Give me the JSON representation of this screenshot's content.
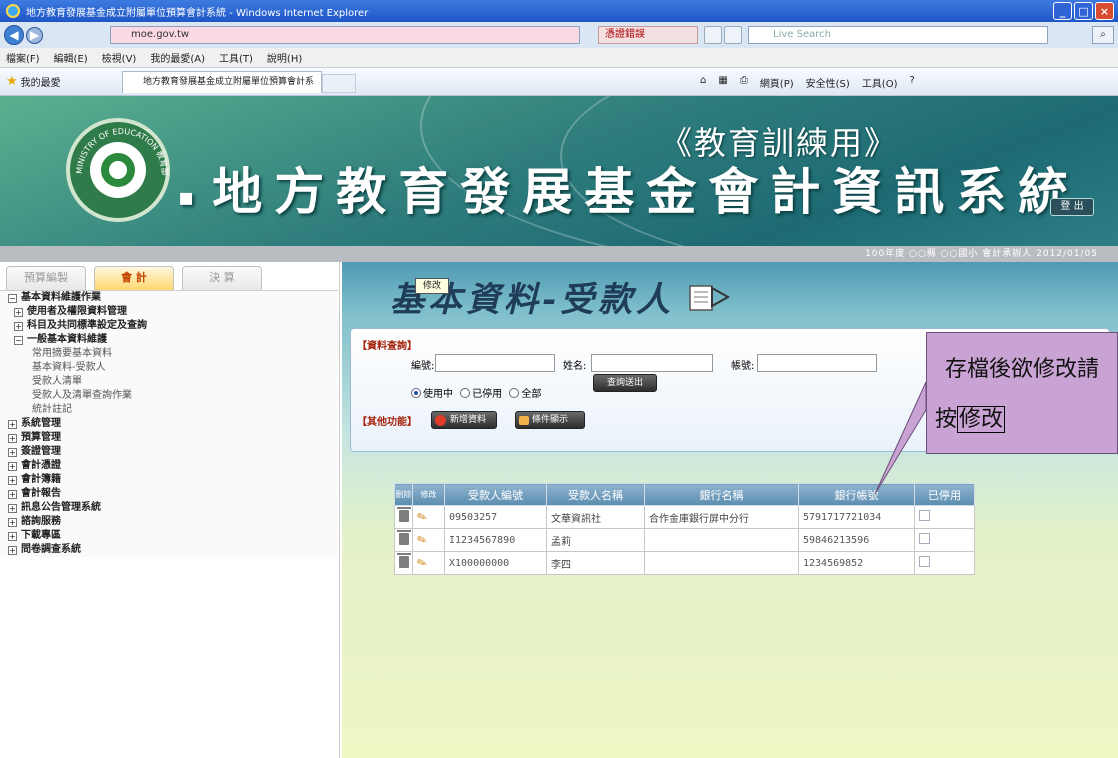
{
  "window": {
    "title": "地方教育發展基金成立附屬單位預算會計系統 - Windows Internet Explorer",
    "controls": [
      "_",
      "□",
      "×"
    ]
  },
  "address_bar": {
    "url": "moe.gov.tw",
    "certificate_error": "憑證錯誤",
    "search_placeholder": "Live Search"
  },
  "menu": [
    "檔案(F)",
    "編輯(E)",
    "檢視(V)",
    "我的最愛(A)",
    "工具(T)",
    "說明(H)"
  ],
  "favorites_bar": {
    "favorites_label": "我的最愛",
    "tab_title": "地方教育發展基金成立附屬單位預算會計系統",
    "commands": [
      "網頁(P)",
      "安全性(S)",
      "工具(O)"
    ]
  },
  "banner": {
    "logo_text": "MINISTRY OF EDUCATION 教育部",
    "system_title": "地方教育發展基金會計資訊系統",
    "training_label": "《教育訓練用》",
    "logout_label": "登 出",
    "status_info": "100年度 ○○縣 ○○國小 會計承辦人 2012/01/05"
  },
  "sidebar": {
    "tabs": [
      {
        "label": "預算編製",
        "active": false
      },
      {
        "label": "會 計",
        "active": true
      },
      {
        "label": "決 算",
        "active": false
      }
    ],
    "tree": [
      {
        "label": "基本資料維護作業",
        "level": 0,
        "expanded": true
      },
      {
        "label": "使用者及權限資料管理",
        "level": 1,
        "expanded": false
      },
      {
        "label": "科目及共同標準設定及查詢",
        "level": 1,
        "expanded": false
      },
      {
        "label": "一般基本資料維護",
        "level": 1,
        "expanded": true
      },
      {
        "label": "常用摘要基本資料",
        "level": 2
      },
      {
        "label": "基本資料-受款人",
        "level": 2
      },
      {
        "label": "受款人清單",
        "level": 2
      },
      {
        "label": "受款人及清單查詢作業",
        "level": 2
      },
      {
        "label": "統計註記",
        "level": 2
      },
      {
        "label": "系統管理",
        "level": 0,
        "expanded": false
      },
      {
        "label": "預算管理",
        "level": 0,
        "expanded": false
      },
      {
        "label": "簽證管理",
        "level": 0,
        "expanded": false
      },
      {
        "label": "會計憑證",
        "level": 0,
        "expanded": false
      },
      {
        "label": "會計簿籍",
        "level": 0,
        "expanded": false
      },
      {
        "label": "會計報告",
        "level": 0,
        "expanded": false
      },
      {
        "label": "訊息公告管理系統",
        "level": 0,
        "expanded": false
      },
      {
        "label": "諮詢服務",
        "level": 0,
        "expanded": false
      },
      {
        "label": "下載專區",
        "level": 0,
        "expanded": false
      },
      {
        "label": "問卷調查系統",
        "level": 0,
        "expanded": false
      }
    ]
  },
  "content": {
    "page_title": "基本資料-受款人",
    "query_section": "【資料查詢】",
    "other_section": "【其他功能】",
    "fields": {
      "code_label": "編號:",
      "name_label": "姓名:",
      "account_label": "帳號:"
    },
    "status_options": [
      {
        "label": "使用中",
        "selected": true
      },
      {
        "label": "已停用",
        "selected": false
      },
      {
        "label": "全部",
        "selected": false
      }
    ],
    "query_button": "查詢送出",
    "add_button": "新增資料",
    "condition_button": "條件顯示",
    "grid": {
      "headers": [
        "刪除",
        "修改",
        "受款人編號",
        "受款人名稱",
        "銀行名稱",
        "銀行帳號",
        "已停用"
      ],
      "rows": [
        {
          "code": "09503257",
          "name": "文華資訊社",
          "bank": "合作金庫銀行屏中分行",
          "account": "5791717721034",
          "disabled": false
        },
        {
          "code": "I1234567890",
          "name": "孟莉",
          "bank": "",
          "account": "59846213596",
          "disabled": false
        },
        {
          "code": "X100000000",
          "name": "李四",
          "bank": "",
          "account": "1234569852",
          "disabled": false
        }
      ]
    },
    "tooltip": "修改"
  },
  "callout": {
    "line1": "存檔後欲修改請",
    "line2_prefix": "按",
    "line2_boxed": "修改"
  }
}
